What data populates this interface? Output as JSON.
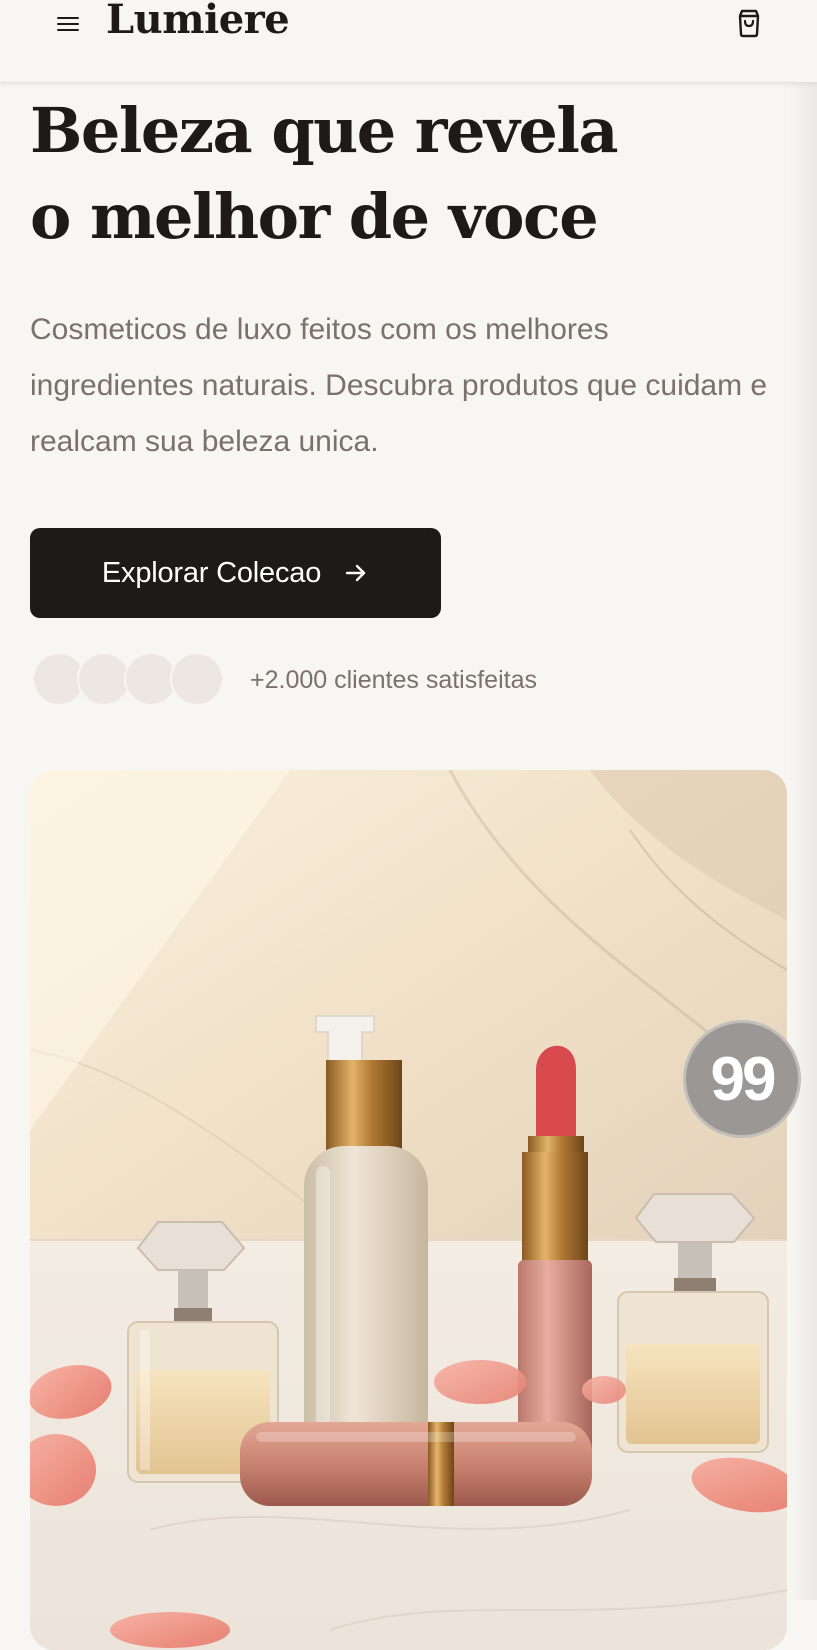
{
  "header": {
    "brand": "Lumiere",
    "menu_icon": "hamburger-menu-icon",
    "cart_icon": "shopping-bag-icon"
  },
  "hero": {
    "title_line1": "Beleza que revela",
    "title_line2": "o melhor de voce",
    "subtitle": "Cosmeticos de luxo feitos com os melhores ingredientes naturais. Descubra produtos que cuidam e realcam sua beleza unica.",
    "cta_label": "Explorar Colecao",
    "cta_icon": "arrow-right-icon"
  },
  "social_proof": {
    "text": "+2.000 clientes satisfeitas"
  },
  "badge": {
    "text": "99"
  },
  "colors": {
    "background": "#f8f6f3",
    "text_primary": "#1e1a17",
    "text_muted": "#7a716a",
    "cta_background": "#1e1a17",
    "avatar_placeholder": "#ece7e2",
    "badge_background": "#9b9794"
  }
}
